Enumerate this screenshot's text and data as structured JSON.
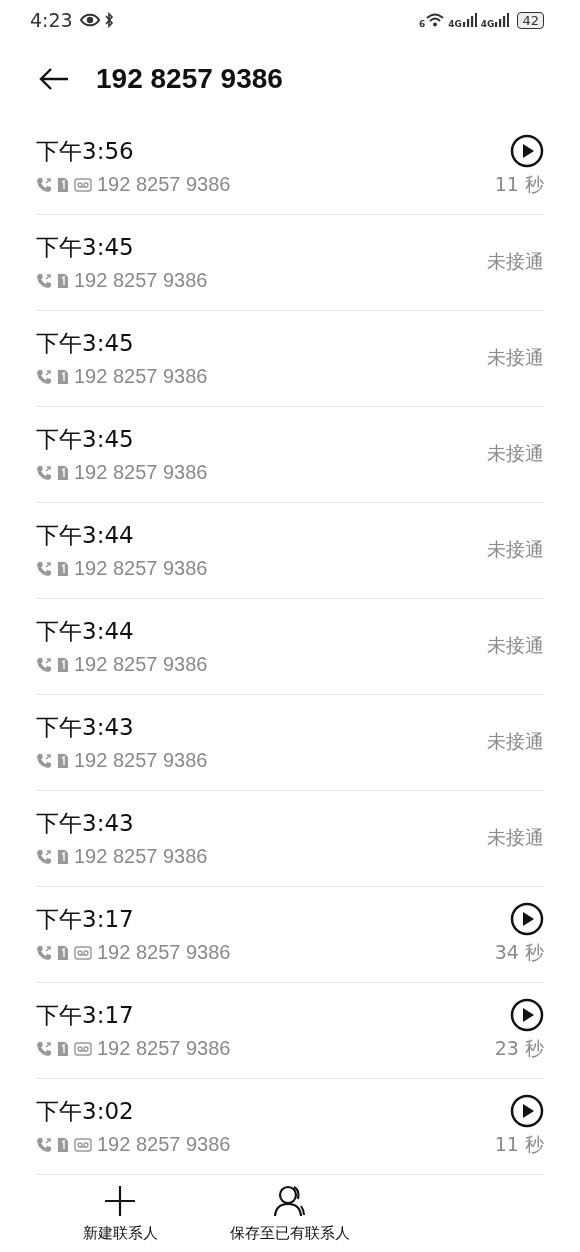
{
  "status_bar": {
    "time": "4:23",
    "wifi_label": "6",
    "signals": [
      "4G",
      "4G"
    ],
    "battery": "42"
  },
  "header": {
    "title": "192 8257 9386"
  },
  "calls": [
    {
      "time": "下午3:56",
      "number": "192 8257 9386",
      "kind": "recorded",
      "result": "11 秒"
    },
    {
      "time": "下午3:45",
      "number": "192 8257 9386",
      "kind": "missed",
      "result": "未接通"
    },
    {
      "time": "下午3:45",
      "number": "192 8257 9386",
      "kind": "missed",
      "result": "未接通"
    },
    {
      "time": "下午3:45",
      "number": "192 8257 9386",
      "kind": "missed",
      "result": "未接通"
    },
    {
      "time": "下午3:44",
      "number": "192 8257 9386",
      "kind": "missed",
      "result": "未接通"
    },
    {
      "time": "下午3:44",
      "number": "192 8257 9386",
      "kind": "missed",
      "result": "未接通"
    },
    {
      "time": "下午3:43",
      "number": "192 8257 9386",
      "kind": "missed",
      "result": "未接通"
    },
    {
      "time": "下午3:43",
      "number": "192 8257 9386",
      "kind": "missed",
      "result": "未接通"
    },
    {
      "time": "下午3:17",
      "number": "192 8257 9386",
      "kind": "recorded",
      "result": "34 秒"
    },
    {
      "time": "下午3:17",
      "number": "192 8257 9386",
      "kind": "recorded",
      "result": "23 秒"
    },
    {
      "time": "下午3:02",
      "number": "192 8257 9386",
      "kind": "recorded",
      "result": "11 秒"
    }
  ],
  "actions": [
    {
      "kind": "new",
      "label": "新建联系人"
    },
    {
      "kind": "existing",
      "label": "保存至已有联系人"
    }
  ]
}
